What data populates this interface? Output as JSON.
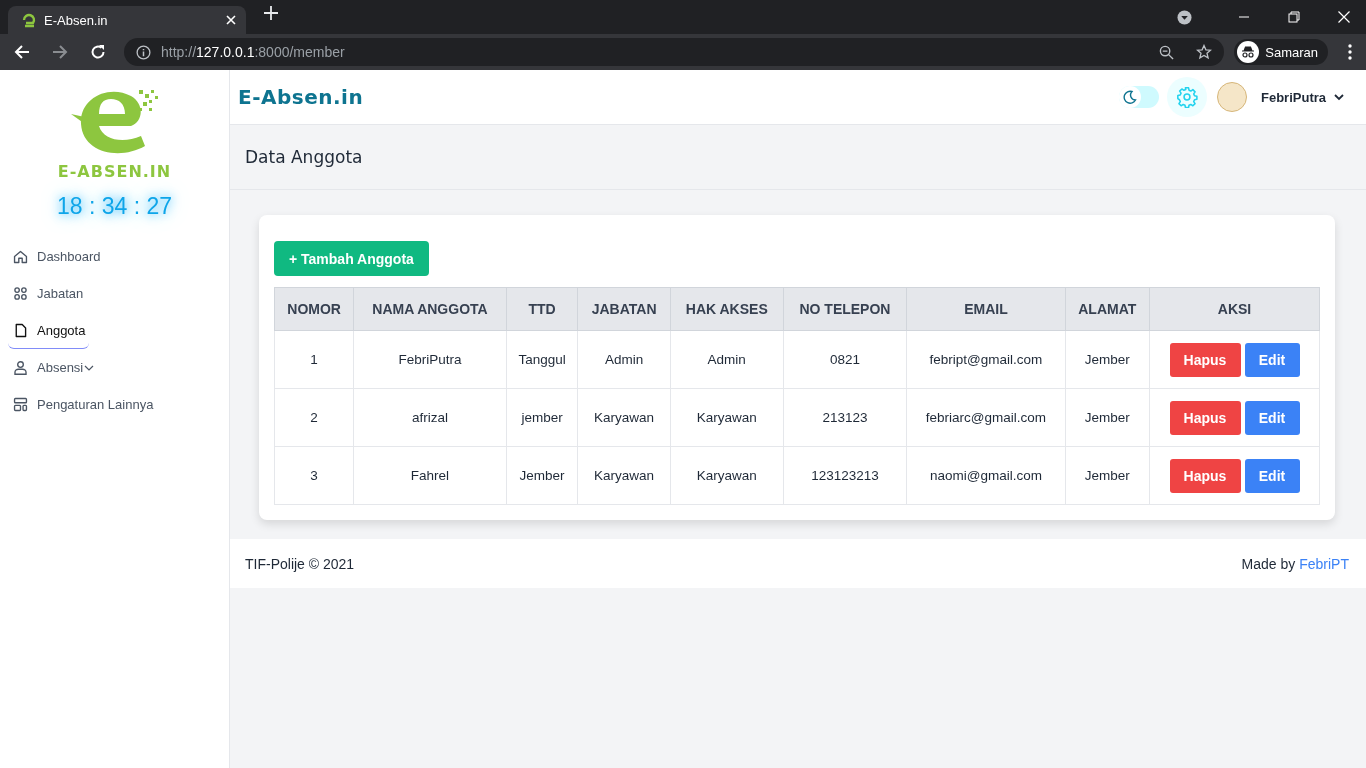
{
  "browser": {
    "tab_title": "E-Absen.in",
    "url": "http://**127.0.0.1**:8000/member",
    "profile": "Samaran"
  },
  "sidebar": {
    "logo_text": "E-ABSEN.IN",
    "clock": "18 : 34 : 27",
    "items": [
      {
        "label": "Dashboard",
        "kind": "home",
        "selected": false,
        "expandable": false
      },
      {
        "label": "Jabatan",
        "kind": "grid",
        "selected": false,
        "expandable": false
      },
      {
        "label": "Anggota",
        "kind": "file",
        "selected": true,
        "expandable": false
      },
      {
        "label": "Absensi",
        "kind": "user",
        "selected": false,
        "expandable": true
      },
      {
        "label": "Pengaturan Lainnya",
        "kind": "layout",
        "selected": false,
        "expandable": false
      }
    ]
  },
  "header": {
    "brand": "E-Absen.in",
    "dark_mode": false,
    "user": "FebriPutra"
  },
  "page_title": "Data Anggota",
  "add_button": "+ Tambah Anggota",
  "table": {
    "columns": [
      "NOMOR",
      "NAMA ANGGOTA",
      "TTD",
      "JABATAN",
      "HAK AKSES",
      "NO TELEPON",
      "EMAIL",
      "ALAMAT",
      "AKSI"
    ],
    "rows": [
      {
        "cells": [
          "1",
          "FebriPutra",
          "Tanggul",
          "Admin",
          "Admin",
          "0821",
          "febript@gmail.com",
          "Jember"
        ],
        "actions": [
          "Hapus",
          "Edit"
        ]
      },
      {
        "cells": [
          "2",
          "afrizal",
          "jember",
          "Karyawan",
          "Karyawan",
          "213123",
          "febriarc@gmail.com",
          "Jember"
        ],
        "actions": [
          "Hapus",
          "Edit"
        ]
      },
      {
        "cells": [
          "3",
          "Fahrel",
          "Jember",
          "Karyawan",
          "Karyawan",
          "123123213",
          "naomi@gmail.com",
          "Jember"
        ],
        "actions": [
          "Hapus",
          "Edit"
        ]
      }
    ]
  },
  "footer": {
    "left": "TIF-Polije © 2021",
    "credit": "Made by ",
    "credit_link": "FebriPT"
  }
}
